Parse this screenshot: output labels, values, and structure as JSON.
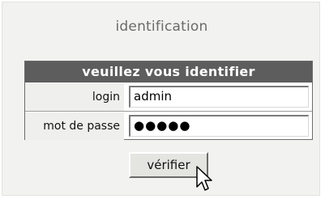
{
  "header": {
    "title": "identification"
  },
  "form": {
    "heading": "veuillez vous identifier",
    "login_label": "login",
    "login_value": "admin",
    "password_label": "mot de passe",
    "password_value": "●●●●●"
  },
  "actions": {
    "submit_label": "vérifier"
  },
  "icons": {
    "cursor": "mouse-pointer-icon"
  }
}
